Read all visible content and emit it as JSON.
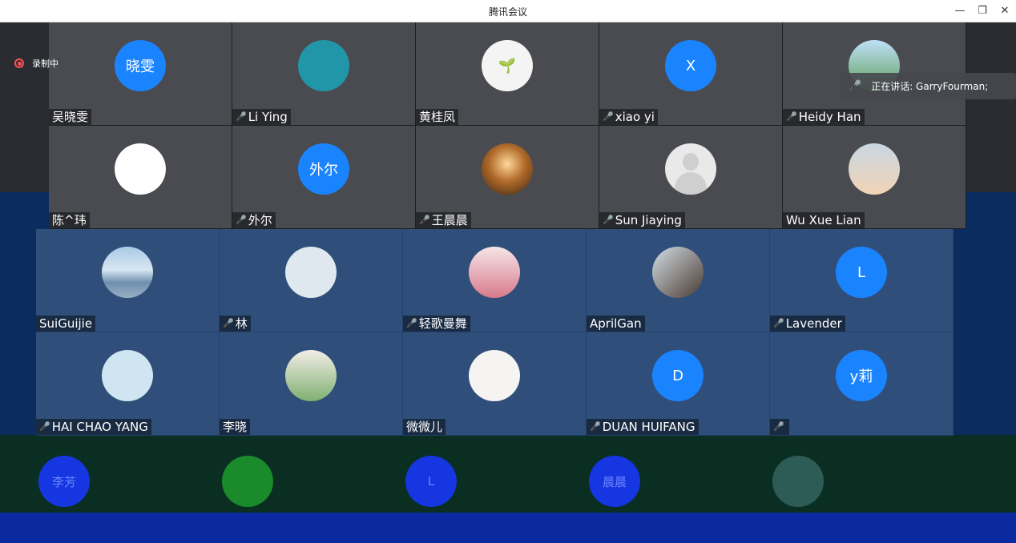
{
  "window": {
    "title": "腾讯会议",
    "minimize": "—",
    "restore": "❐",
    "close": "✕"
  },
  "recording": {
    "label": "录制中"
  },
  "speaking": {
    "label": "正在讲话: GarryFourman;",
    "icon": "mic-icon"
  },
  "participants": [
    {
      "name": "吴晓雯",
      "avatar_text": "晓雯",
      "avatar_style": "av-blue",
      "mic": false
    },
    {
      "name": "Li Ying",
      "avatar_text": "",
      "avatar_style": "av-teal",
      "mic": true
    },
    {
      "name": "黄桂凤",
      "avatar_text": "🌱",
      "avatar_style": "av-white",
      "mic": false
    },
    {
      "name": "xiao yi",
      "avatar_text": "X",
      "avatar_style": "av-blue",
      "mic": true
    },
    {
      "name": "Heidy Han",
      "avatar_text": "",
      "avatar_style": "av-flower",
      "mic": true
    },
    {
      "name": "陈^玮",
      "avatar_text": "",
      "avatar_style": "av-stickers",
      "mic": false
    },
    {
      "name": "外尔",
      "avatar_text": "外尔",
      "avatar_style": "av-blue",
      "mic": true
    },
    {
      "name": "王晨晨",
      "avatar_text": "",
      "avatar_style": "av-photo1",
      "mic": true
    },
    {
      "name": "Sun Jiaying",
      "avatar_text": "",
      "avatar_style": "av-person",
      "mic": true
    },
    {
      "name": "Wu  Xue Lian",
      "avatar_text": "",
      "avatar_style": "av-sunset",
      "mic": false
    },
    {
      "name": "SuiGuijie",
      "avatar_text": "",
      "avatar_style": "av-sea",
      "mic": false
    },
    {
      "name": "林",
      "avatar_text": "",
      "avatar_style": "av-cartoon",
      "mic": true
    },
    {
      "name": "轻歌曼舞",
      "avatar_text": "",
      "avatar_style": "av-girl",
      "mic": true
    },
    {
      "name": "AprilGan",
      "avatar_text": "",
      "avatar_style": "av-family",
      "mic": false
    },
    {
      "name": "Lavender",
      "avatar_text": "L",
      "avatar_style": "av-blue",
      "mic": true
    },
    {
      "name": "HAI CHAO YANG",
      "avatar_text": "",
      "avatar_style": "av-kiki",
      "mic": true
    },
    {
      "name": "李晓",
      "avatar_text": "",
      "avatar_style": "av-lady",
      "mic": false
    },
    {
      "name": "微微儿",
      "avatar_text": "",
      "avatar_style": "av-sketch",
      "mic": false
    },
    {
      "name": "DUAN HUIFANG",
      "avatar_text": "D",
      "avatar_style": "av-blue",
      "mic": true
    },
    {
      "name": "",
      "avatar_text": "y莉",
      "avatar_style": "av-blue",
      "mic": true
    }
  ],
  "ghost_row": [
    {
      "avatar_text": "李芳",
      "style": "ghost-blue"
    },
    {
      "avatar_text": "",
      "style": "ghost-green"
    },
    {
      "avatar_text": "L",
      "style": "ghost-blue"
    },
    {
      "avatar_text": "晨晨",
      "style": "ghost-blue"
    },
    {
      "avatar_text": "",
      "style": "ghost-teal"
    }
  ],
  "colors": {
    "tile_gray": "#4a4b50",
    "tile_blue": "#2f4f7a",
    "avatar_blue": "#1a84ff",
    "recording_red": "#ff5252"
  }
}
